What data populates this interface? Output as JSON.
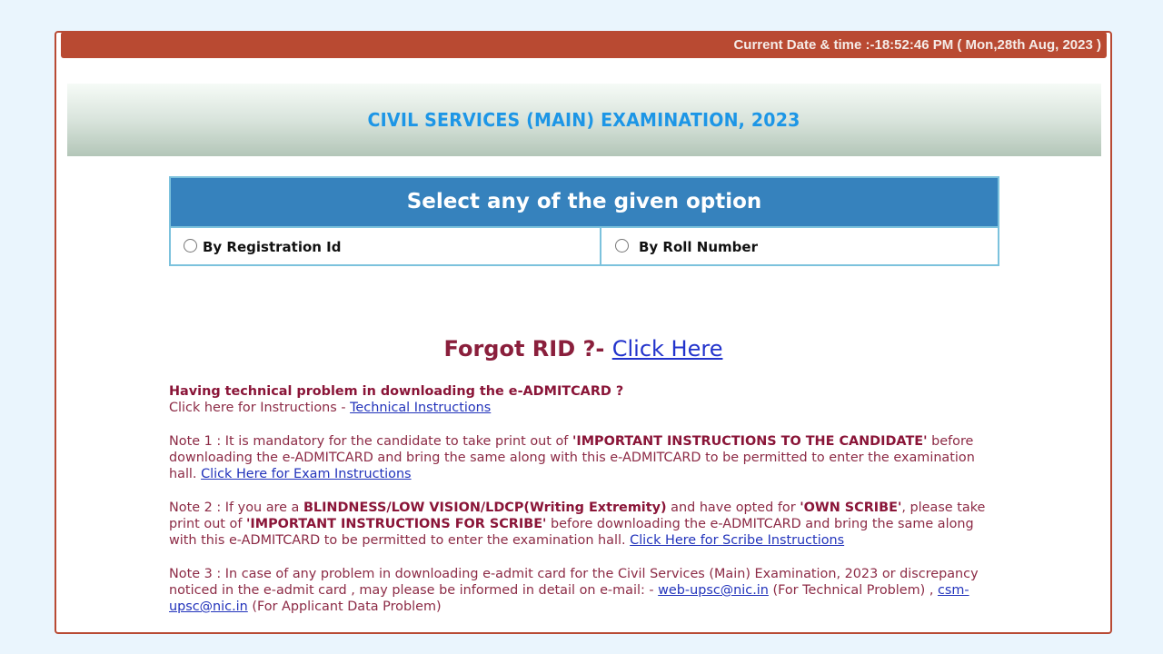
{
  "header": {
    "datetime_text": "Current Date & time :-18:52:46 PM ( Mon,28th Aug, 2023 )"
  },
  "banner": {
    "title": "CIVIL SERVICES (MAIN) EXAMINATION, 2023"
  },
  "options": {
    "heading": "Select any of the given option",
    "items": [
      {
        "label": "By Registration Id",
        "selected": false
      },
      {
        "label": "By Roll Number",
        "selected": false
      }
    ]
  },
  "forgot": {
    "label": "Forgot RID ?-",
    "link": "Click Here"
  },
  "technical": {
    "heading": "Having technical problem in downloading the e-ADMITCARD ?",
    "text": "Click here for Instructions - ",
    "link": "Technical Instructions"
  },
  "note1": {
    "prefix": "Note 1 : It is mandatory for the candidate to take print out of ",
    "bold": "'IMPORTANT INSTRUCTIONS TO THE CANDIDATE'",
    "text": " before downloading the e-ADMITCARD and bring the same along with this e-ADMITCARD to be permitted to enter the examination hall. ",
    "link": "Click Here for Exam Instructions"
  },
  "note2": {
    "prefix": "Note 2 : If you are a ",
    "bold1": "BLINDNESS/LOW VISION/LDCP(Writing Extremity)",
    "mid1": " and have opted for ",
    "bold2": "'OWN SCRIBE'",
    "mid2": ", please take print out of ",
    "bold3": "'IMPORTANT INSTRUCTIONS FOR SCRIBE'",
    "text": " before downloading the e-ADMITCARD and bring the same along with this e-ADMITCARD to be permitted to enter the examination hall. ",
    "link": "Click Here for Scribe Instructions"
  },
  "note3": {
    "prefix": "Note 3 : In case of any problem in downloading e-admit card for the Civil Services (Main) Examination, 2023 or discrepancy noticed in the e-admit card , may please be informed in detail on e-mail: - ",
    "email1": "web-upsc@nic.in",
    "mid": " (For Technical Problem) , ",
    "email2": "csm-upsc@nic.in",
    "suffix": " (For Applicant Data Problem)"
  }
}
